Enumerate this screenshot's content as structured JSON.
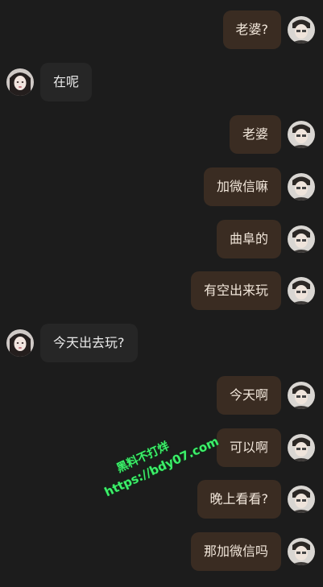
{
  "messages": [
    {
      "side": "out",
      "text": "老婆?"
    },
    {
      "side": "in",
      "text": "在呢"
    },
    {
      "side": "out",
      "text": "老婆"
    },
    {
      "side": "out",
      "text": "加微信嘛"
    },
    {
      "side": "out",
      "text": "曲阜的"
    },
    {
      "side": "out",
      "text": "有空出来玩"
    },
    {
      "side": "in",
      "text": "今天出去玩?"
    },
    {
      "side": "out",
      "text": "今天啊"
    },
    {
      "side": "out",
      "text": "可以啊"
    },
    {
      "side": "out",
      "text": "晚上看看?"
    },
    {
      "side": "out",
      "text": "那加微信吗"
    }
  ],
  "watermark": {
    "line1": "黑料不打烊",
    "line2": "https://bdy07.com"
  },
  "colors": {
    "background": "#1c1c1c",
    "outgoing_bubble": "#3a2c22",
    "incoming_bubble": "#262626",
    "watermark": "#3cf06a"
  }
}
